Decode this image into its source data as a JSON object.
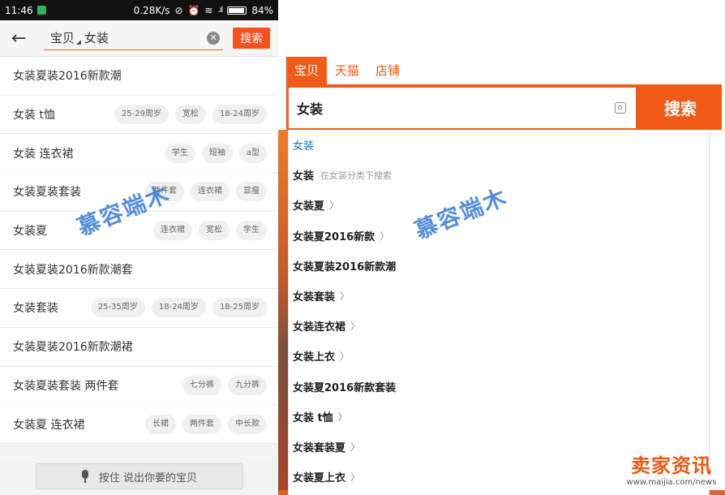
{
  "left": {
    "status_bar": {
      "time": "11:46",
      "speed": "0.28K/s",
      "battery": "84%",
      "battery_level": 0.84
    },
    "search": {
      "scope": "宝贝",
      "query": "女装",
      "button": "搜索"
    },
    "suggestions": [
      {
        "text": "女装夏装2016新款潮",
        "tags": []
      },
      {
        "text": "女装 t恤",
        "tags": [
          "25-29周岁",
          "宽松",
          "18-24周岁"
        ]
      },
      {
        "text": "女装 连衣裙",
        "tags": [
          "学生",
          "短袖",
          "a型"
        ]
      },
      {
        "text": "女装夏装套装",
        "tags": [
          "两件套",
          "连衣裙",
          "显瘦"
        ]
      },
      {
        "text": "女装夏",
        "tags": [
          "连衣裙",
          "宽松",
          "学生"
        ]
      },
      {
        "text": "女装夏装2016新款潮套",
        "tags": []
      },
      {
        "text": "女装套装",
        "tags": [
          "25-35周岁",
          "18-24周岁",
          "18-25周岁"
        ]
      },
      {
        "text": "女装夏装2016新款潮裙",
        "tags": []
      },
      {
        "text": "女装夏装套装 两件套",
        "tags": [
          "七分裤",
          "九分裤"
        ]
      },
      {
        "text": "女装夏 连衣裙",
        "tags": [
          "长裙",
          "两件套",
          "中长款"
        ]
      }
    ],
    "voice_button": "按住 说出你要的宝贝"
  },
  "right": {
    "tabs": [
      "宝贝",
      "天猫",
      "店铺"
    ],
    "query": "女装",
    "search_button": "搜索",
    "suggestions": [
      {
        "text": "女装",
        "hint": "",
        "chevron": false
      },
      {
        "text": "女装",
        "hint": "在女装分类下搜索",
        "chevron": false
      },
      {
        "text": "女装夏",
        "hint": "",
        "chevron": true
      },
      {
        "text": "女装夏2016新款",
        "hint": "",
        "chevron": true
      },
      {
        "text": "女装夏装2016新款潮",
        "hint": "",
        "chevron": false
      },
      {
        "text": "女装套装",
        "hint": "",
        "chevron": true
      },
      {
        "text": "女装连衣裙",
        "hint": "",
        "chevron": true
      },
      {
        "text": "女装上衣",
        "hint": "",
        "chevron": true
      },
      {
        "text": "女装夏2016新款套装",
        "hint": "",
        "chevron": false
      },
      {
        "text": "女装 t恤",
        "hint": "",
        "chevron": true
      },
      {
        "text": "女装套装夏",
        "hint": "",
        "chevron": true
      },
      {
        "text": "女装夏上衣",
        "hint": "",
        "chevron": true
      }
    ]
  },
  "watermark": "慕容端木",
  "corner_logo": {
    "name": "卖家资讯",
    "url": "www.maijia.com/news"
  },
  "colors": {
    "accent": "#f25a1a",
    "link": "#1a6fc2",
    "watermark": "#3a7bd5"
  }
}
